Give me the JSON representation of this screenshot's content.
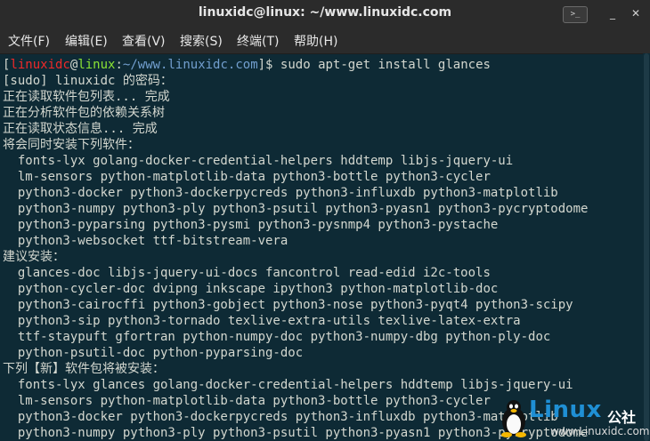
{
  "window": {
    "title": "linuxidc@linux: ~/www.linuxidc.com",
    "terminal_button": ">_",
    "minimize": "_",
    "close": "✕"
  },
  "menu": [
    "文件(F)",
    "编辑(E)",
    "查看(V)",
    "搜索(S)",
    "终端(T)",
    "帮助(H)"
  ],
  "prompt": {
    "open": "[",
    "user": "linuxidc",
    "at": "@",
    "host": "linux",
    "colon": ":",
    "path": "~/www.linuxidc.com",
    "close": "]$ ",
    "command": "sudo apt-get install glances"
  },
  "output": [
    "[sudo] linuxidc 的密码：",
    "正在读取软件包列表... 完成",
    "正在分析软件包的依赖关系树",
    "正在读取状态信息... 完成",
    "将会同时安装下列软件：",
    "  fonts-lyx golang-docker-credential-helpers hddtemp libjs-jquery-ui",
    "  lm-sensors python-matplotlib-data python3-bottle python3-cycler",
    "  python3-docker python3-dockerpycreds python3-influxdb python3-matplotlib",
    "  python3-numpy python3-ply python3-psutil python3-pyasn1 python3-pycryptodome",
    "  python3-pyparsing python3-pysmi python3-pysnmp4 python3-pystache",
    "  python3-websocket ttf-bitstream-vera",
    "建议安装：",
    "  glances-doc libjs-jquery-ui-docs fancontrol read-edid i2c-tools",
    "  python-cycler-doc dvipng inkscape ipython3 python-matplotlib-doc",
    "  python3-cairocffi python3-gobject python3-nose python3-pyqt4 python3-scipy",
    "  python3-sip python3-tornado texlive-extra-utils texlive-latex-extra",
    "  ttf-staypuft gfortran python-numpy-doc python3-numpy-dbg python-ply-doc",
    "  python-psutil-doc python-pyparsing-doc",
    "下列【新】软件包将被安装：",
    "  fonts-lyx glances golang-docker-credential-helpers hddtemp libjs-jquery-ui",
    "  lm-sensors python-matplotlib-data python3-bottle python3-cycler",
    "  python3-docker python3-dockerpycreds python3-influxdb python3-matplotlib",
    "  python3-numpy python3-ply python3-psutil python3-pyasn1 python3-pycryptodome"
  ],
  "watermark": {
    "brand": "Linux",
    "cn": "公社",
    "url": "www.Linuxidc.com"
  },
  "colors": {
    "background": "#0e2a35",
    "text": "#d3d7cf",
    "user": "#ef2929",
    "host": "#8ae234",
    "path": "#729fcf",
    "titlebar": "#2b2b2b"
  }
}
